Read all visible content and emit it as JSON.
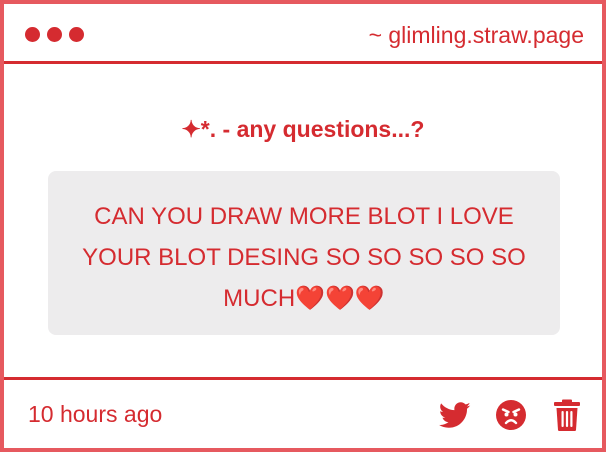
{
  "window": {
    "url": "~ glimling.straw.page"
  },
  "content": {
    "prompt": "✦*. - any questions...?",
    "question": "CAN YOU DRAW MORE BLOT I LOVE YOUR BLOT DESING SO SO SO SO SO MUCH❤️❤️❤️"
  },
  "footer": {
    "timestamp": "10 hours ago",
    "actions": [
      {
        "icon": "twitter-icon"
      },
      {
        "icon": "angry-face-icon"
      },
      {
        "icon": "trash-icon"
      }
    ]
  },
  "colors": {
    "accent": "#d52b30",
    "outer_background": "#e6595f",
    "panel_background": "#ffffff",
    "question_background": "#edeced"
  }
}
